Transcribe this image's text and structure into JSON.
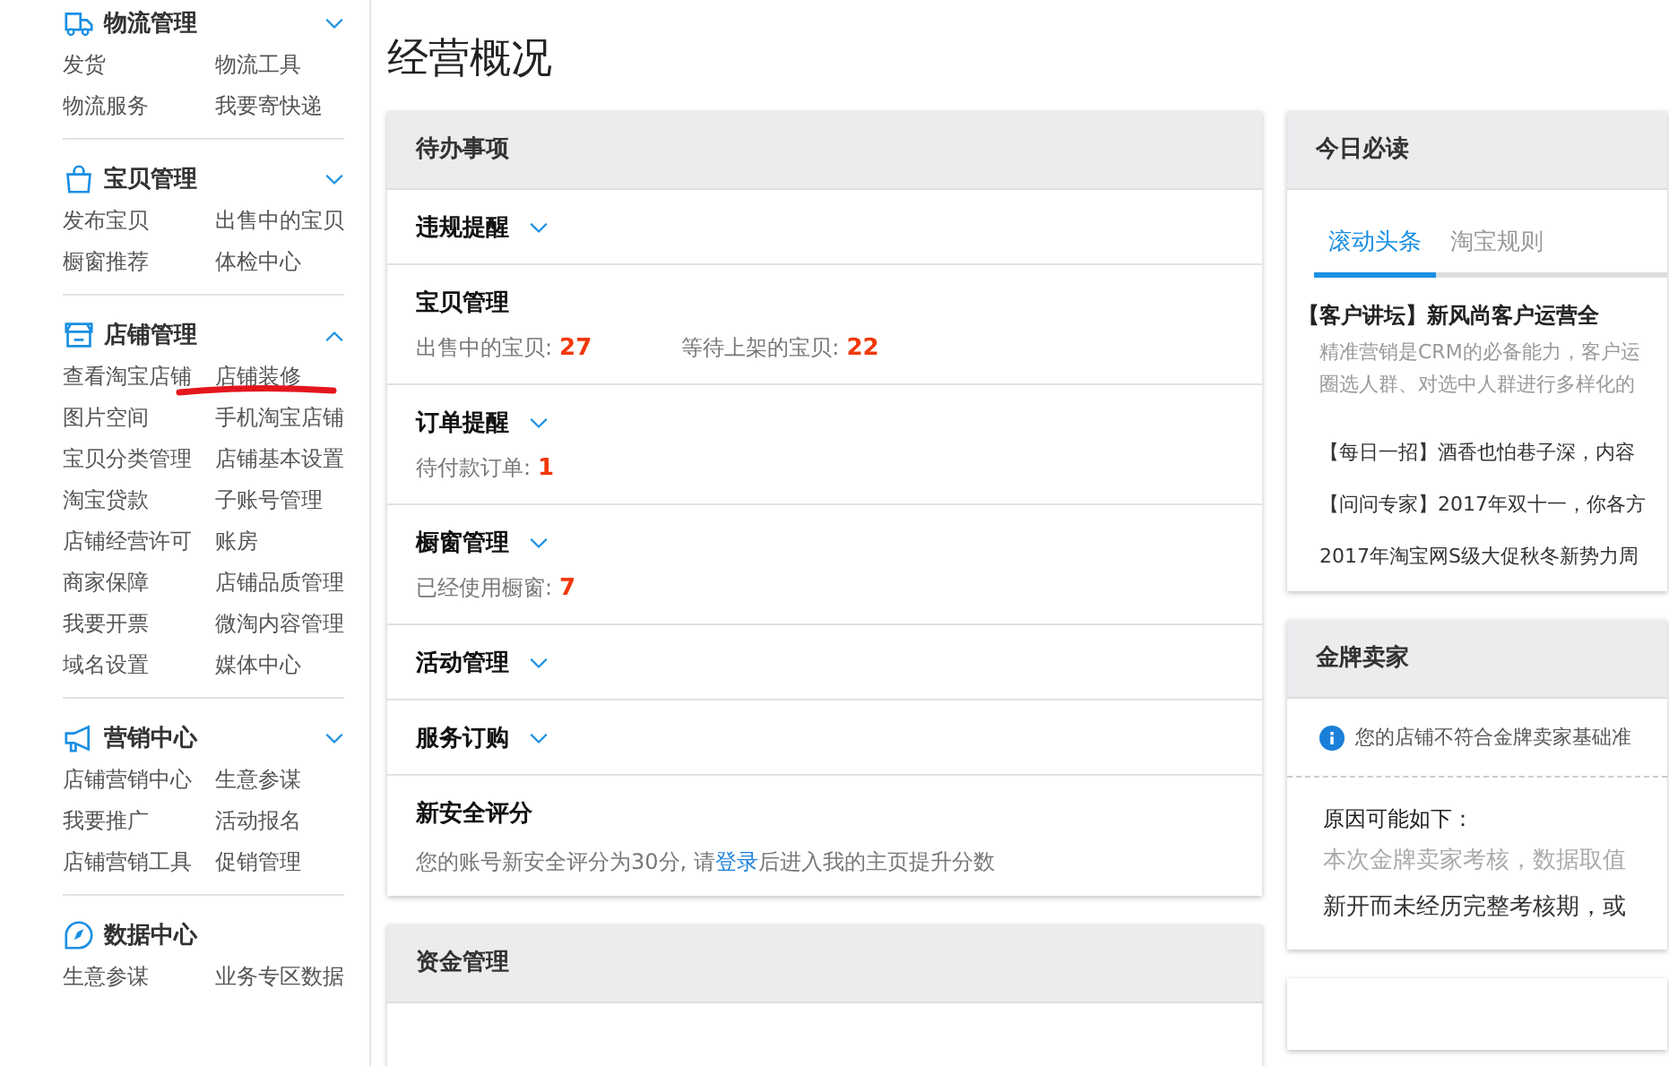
{
  "sidebar": {
    "sections": [
      {
        "title": "物流管理",
        "kind": "truck",
        "expanded": false,
        "items": [
          {
            "label": "发货",
            "annotated": false
          },
          {
            "label": "物流工具",
            "annotated": false
          },
          {
            "label": "物流服务",
            "annotated": false
          },
          {
            "label": "我要寄快递",
            "annotated": false
          }
        ]
      },
      {
        "title": "宝贝管理",
        "kind": "bag",
        "expanded": false,
        "items": [
          {
            "label": "发布宝贝",
            "annotated": false
          },
          {
            "label": "出售中的宝贝",
            "annotated": false
          },
          {
            "label": "橱窗推荐",
            "annotated": false
          },
          {
            "label": "体检中心",
            "annotated": false
          }
        ]
      },
      {
        "title": "店铺管理",
        "kind": "store",
        "expanded": true,
        "items": [
          {
            "label": "查看淘宝店铺",
            "annotated": false
          },
          {
            "label": "店铺装修",
            "annotated": true
          },
          {
            "label": "图片空间",
            "annotated": false
          },
          {
            "label": "手机淘宝店铺",
            "annotated": false
          },
          {
            "label": "宝贝分类管理",
            "annotated": false
          },
          {
            "label": "店铺基本设置",
            "annotated": false
          },
          {
            "label": "淘宝贷款",
            "annotated": false
          },
          {
            "label": "子账号管理",
            "annotated": false
          },
          {
            "label": "店铺经营许可",
            "annotated": false
          },
          {
            "label": "账房",
            "annotated": false
          },
          {
            "label": "商家保障",
            "annotated": false
          },
          {
            "label": "店铺品质管理",
            "annotated": false
          },
          {
            "label": "我要开票",
            "annotated": false
          },
          {
            "label": "微淘内容管理",
            "annotated": false
          },
          {
            "label": "域名设置",
            "annotated": false
          },
          {
            "label": "媒体中心",
            "annotated": false
          }
        ]
      },
      {
        "title": "营销中心",
        "kind": "megaphone",
        "expanded": false,
        "items": [
          {
            "label": "店铺营销中心",
            "annotated": false
          },
          {
            "label": "生意参谋",
            "annotated": false
          },
          {
            "label": "我要推广",
            "annotated": false
          },
          {
            "label": "活动报名",
            "annotated": false
          },
          {
            "label": "店铺营销工具",
            "annotated": false
          },
          {
            "label": "促销管理",
            "annotated": false
          }
        ]
      },
      {
        "title": "数据中心",
        "kind": "compass",
        "items": [
          {
            "label": "生意参谋",
            "annotated": false
          },
          {
            "label": "业务专区数据",
            "annotated": false
          }
        ]
      }
    ]
  },
  "page_title": "经营概况",
  "todo": {
    "title": "待办事项",
    "rows": [
      {
        "title": "违规提醒",
        "toggle": true
      },
      {
        "title": "宝贝管理",
        "toggle": false,
        "stats": [
          {
            "label": "出售中的宝贝:",
            "value": "27"
          },
          {
            "label": "等待上架的宝贝:",
            "value": "22"
          }
        ]
      },
      {
        "title": "订单提醒",
        "toggle": true,
        "stats": [
          {
            "label": "待付款订单:",
            "value": "1"
          }
        ]
      },
      {
        "title": "橱窗管理",
        "toggle": true,
        "stats": [
          {
            "label": "已经使用橱窗:",
            "value": "7"
          }
        ]
      },
      {
        "title": "活动管理",
        "toggle": true
      },
      {
        "title": "服务订购",
        "toggle": true
      },
      {
        "title": "新安全评分",
        "toggle": false,
        "note": {
          "before": "您的账号新安全评分为30分, 请",
          "link": "登录",
          "after": "后进入我的主页提升分数"
        }
      }
    ]
  },
  "funds": {
    "title": "资金管理"
  },
  "today": {
    "title": "今日必读",
    "tabs": [
      {
        "label": "滚动头条",
        "selected": true
      },
      {
        "label": "淘宝规则",
        "selected": false
      }
    ],
    "headline": "【客户讲坛】新风尚客户运营全",
    "excerpt": [
      "精准营销是CRM的必备能力，客户运",
      "圈选人群、对选中人群进行多样化的"
    ],
    "news": [
      "【每日一招】酒香也怕巷子深，内容",
      "【问问专家】2017年双十一，你各方",
      "2017年淘宝网S级大促秋冬新势力周"
    ]
  },
  "gold": {
    "title": "金牌卖家",
    "notice": "您的店铺不符合金牌卖家基础准",
    "reasons_title": "原因可能如下：",
    "reasons": [
      {
        "text": "本次金牌卖家考核，数据取值",
        "muted": true
      },
      {
        "text": "新开而未经历完整考核期，或",
        "muted": false
      }
    ]
  }
}
